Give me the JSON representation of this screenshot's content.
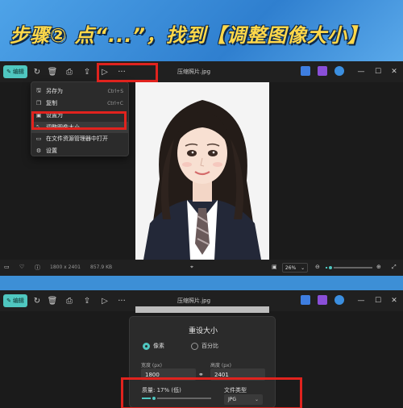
{
  "headline": "步骤② 点“...”，找到【调整图像大小】",
  "window1": {
    "title": "压缩照片.jpg",
    "edit_label": "编辑",
    "toolbar_icons": [
      "rotate-icon",
      "delete-icon",
      "print-icon",
      "share-icon",
      "slideshow-icon",
      "more-icon"
    ],
    "more_label": "···",
    "menu": [
      {
        "icon": "save-as-icon",
        "label": "另存为",
        "shortcut": "Ctrl+S"
      },
      {
        "icon": "copy-icon",
        "label": "复制",
        "shortcut": "Ctrl+C"
      },
      {
        "icon": "set-as-icon",
        "label": "设置为",
        "shortcut": ""
      },
      {
        "icon": "resize-icon",
        "label": "调整图像大小",
        "shortcut": ""
      },
      {
        "icon": "folder-icon",
        "label": "在文件资源管理器中打开",
        "shortcut": ""
      },
      {
        "icon": "settings-icon",
        "label": "设置",
        "shortcut": ""
      }
    ],
    "status": {
      "dimensions": "1800 x 2401",
      "filesize": "857.9 KB",
      "zoom": "26%",
      "zoom_level": 0.1
    }
  },
  "window2": {
    "title": "压缩照片.jpg",
    "edit_label": "编辑",
    "dialog": {
      "title": "重设大小",
      "option_pixels": "像素",
      "option_percent": "百分比",
      "width_label": "宽度 (px)",
      "width_value": "1800",
      "height_label": "高度 (px)",
      "height_value": "2401",
      "quality_label": "质量: 17% (低)",
      "quality_level": 0.17,
      "filetype_label": "文件类型",
      "filetype_value": "JPG"
    }
  },
  "colors": {
    "accent": "#4fc7c0",
    "highlight": "#e0231e",
    "headline": "#ffd84a",
    "background": "#3d8fd6"
  }
}
